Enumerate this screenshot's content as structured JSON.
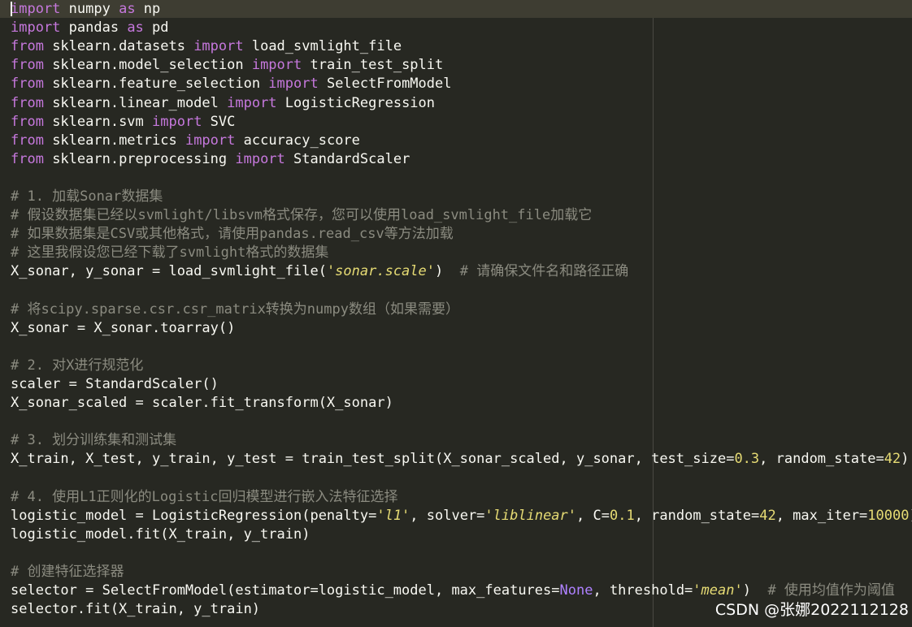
{
  "code_lines": [
    [
      {
        "t": "import",
        "c": "kw"
      },
      {
        "t": " numpy "
      },
      {
        "t": "as",
        "c": "kw"
      },
      {
        "t": " np"
      }
    ],
    [
      {
        "t": "import",
        "c": "kw"
      },
      {
        "t": " pandas "
      },
      {
        "t": "as",
        "c": "kw"
      },
      {
        "t": " pd"
      }
    ],
    [
      {
        "t": "from",
        "c": "kw"
      },
      {
        "t": " sklearn.datasets "
      },
      {
        "t": "import",
        "c": "kw"
      },
      {
        "t": " load_svmlight_file"
      }
    ],
    [
      {
        "t": "from",
        "c": "kw"
      },
      {
        "t": " sklearn.model_selection "
      },
      {
        "t": "import",
        "c": "kw"
      },
      {
        "t": " train_test_split"
      }
    ],
    [
      {
        "t": "from",
        "c": "kw"
      },
      {
        "t": " sklearn.feature_selection "
      },
      {
        "t": "import",
        "c": "kw"
      },
      {
        "t": " SelectFromModel"
      }
    ],
    [
      {
        "t": "from",
        "c": "kw"
      },
      {
        "t": " sklearn.linear_model "
      },
      {
        "t": "import",
        "c": "kw"
      },
      {
        "t": " LogisticRegression"
      }
    ],
    [
      {
        "t": "from",
        "c": "kw"
      },
      {
        "t": " sklearn.svm "
      },
      {
        "t": "import",
        "c": "kw"
      },
      {
        "t": " SVC"
      }
    ],
    [
      {
        "t": "from",
        "c": "kw"
      },
      {
        "t": " sklearn.metrics "
      },
      {
        "t": "import",
        "c": "kw"
      },
      {
        "t": " accuracy_score"
      }
    ],
    [
      {
        "t": "from",
        "c": "kw"
      },
      {
        "t": " sklearn.preprocessing "
      },
      {
        "t": "import",
        "c": "kw"
      },
      {
        "t": " StandardScaler"
      }
    ],
    [],
    [
      {
        "t": "# 1. 加载Sonar数据集",
        "c": "cmt"
      }
    ],
    [
      {
        "t": "# 假设数据集已经以svmlight/libsvm格式保存，您可以使用load_svmlight_file加载它",
        "c": "cmt"
      }
    ],
    [
      {
        "t": "# 如果数据集是CSV或其他格式，请使用pandas.read_csv等方法加载",
        "c": "cmt"
      }
    ],
    [
      {
        "t": "# 这里我假设您已经下载了svmlight格式的数据集",
        "c": "cmt"
      }
    ],
    [
      {
        "t": "X_sonar, y_sonar = load_svmlight_file("
      },
      {
        "t": "'sonar.scale'",
        "c": "str"
      },
      {
        "t": ")  "
      },
      {
        "t": "# 请确保文件名和路径正确",
        "c": "cmt"
      }
    ],
    [],
    [
      {
        "t": "# 将scipy.sparse.csr.csr_matrix转换为numpy数组（如果需要）",
        "c": "cmt"
      }
    ],
    [
      {
        "t": "X_sonar = X_sonar.toarray()"
      }
    ],
    [],
    [
      {
        "t": "# 2. 对X进行规范化",
        "c": "cmt"
      }
    ],
    [
      {
        "t": "scaler = StandardScaler()"
      }
    ],
    [
      {
        "t": "X_sonar_scaled = scaler.fit_transform(X_sonar)"
      }
    ],
    [],
    [
      {
        "t": "# 3. 划分训练集和测试集",
        "c": "cmt"
      }
    ],
    [
      {
        "t": "X_train, X_test, y_train, y_test = train_test_split(X_sonar_scaled, y_sonar, test_size="
      },
      {
        "t": "0.3",
        "c": "num"
      },
      {
        "t": ", random_state="
      },
      {
        "t": "42",
        "c": "num"
      },
      {
        "t": ")"
      }
    ],
    [],
    [
      {
        "t": "# 4. 使用L1正则化的Logistic回归模型进行嵌入法特征选择",
        "c": "cmt"
      }
    ],
    [
      {
        "t": "logistic_model = LogisticRegression(penalty="
      },
      {
        "t": "'l1'",
        "c": "str"
      },
      {
        "t": ", solver="
      },
      {
        "t": "'liblinear'",
        "c": "str"
      },
      {
        "t": ", C="
      },
      {
        "t": "0.1",
        "c": "num"
      },
      {
        "t": ", random_state="
      },
      {
        "t": "42",
        "c": "num"
      },
      {
        "t": ", max_iter="
      },
      {
        "t": "10000",
        "c": "num"
      },
      {
        "t": ")"
      }
    ],
    [
      {
        "t": "logistic_model.fit(X_train, y_train)"
      }
    ],
    [],
    [
      {
        "t": "# 创建特征选择器",
        "c": "cmt"
      }
    ],
    [
      {
        "t": "selector = SelectFromModel(estimator=logistic_model, max_features="
      },
      {
        "t": "None",
        "c": "none"
      },
      {
        "t": ", threshold="
      },
      {
        "t": "'mean'",
        "c": "str"
      },
      {
        "t": ")  "
      },
      {
        "t": "# 使用均值作为阈值",
        "c": "cmt"
      }
    ],
    [
      {
        "t": "selector.fit(X_train, y_train)"
      }
    ]
  ],
  "watermark": "CSDN @张娜2022112128"
}
